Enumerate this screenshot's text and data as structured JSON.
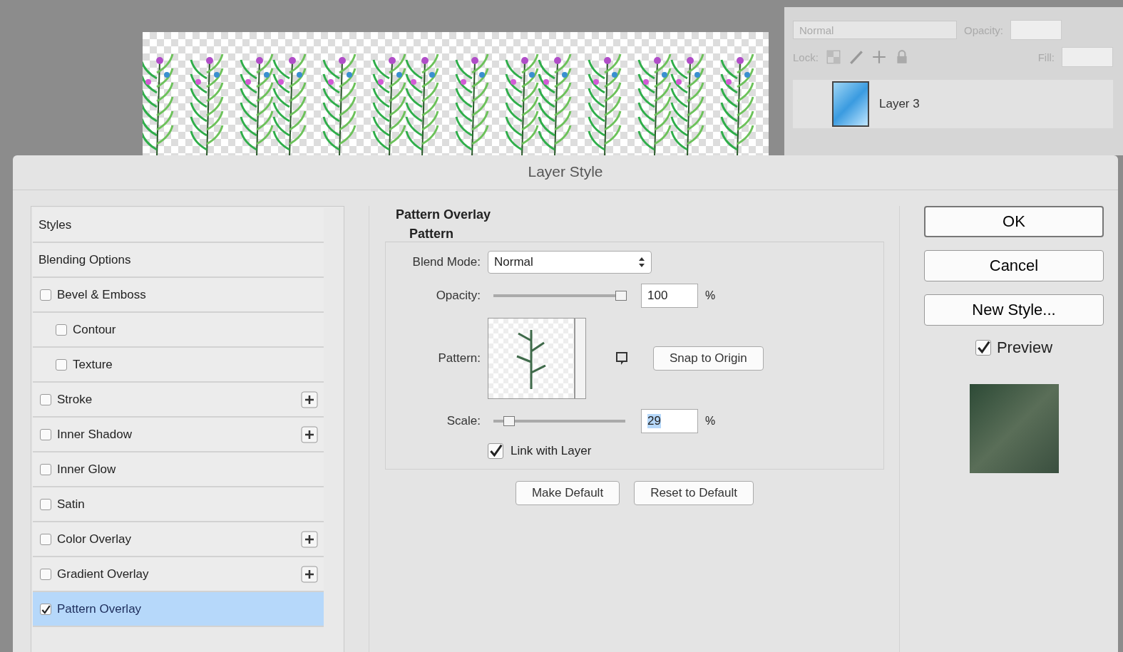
{
  "layers_panel": {
    "blend_mode": "Normal",
    "opacity_label": "Opacity:",
    "lock_label": "Lock:",
    "fill_label": "Fill:",
    "layers": [
      {
        "name": "Layer 3"
      }
    ]
  },
  "dialog": {
    "title": "Layer Style",
    "styles": [
      {
        "label": "Styles",
        "kind": "header",
        "selected": false
      },
      {
        "label": "Blending Options",
        "kind": "plain",
        "selected": false
      },
      {
        "label": "Bevel & Emboss",
        "kind": "check",
        "checked": false,
        "selected": false,
        "add_button": false,
        "children": [
          {
            "label": "Contour",
            "kind": "check",
            "checked": false,
            "selected": false,
            "add_button": false
          },
          {
            "label": "Texture",
            "kind": "check",
            "checked": false,
            "selected": false,
            "add_button": false
          }
        ]
      },
      {
        "label": "Stroke",
        "kind": "check",
        "checked": false,
        "selected": false,
        "add_button": true
      },
      {
        "label": "Inner Shadow",
        "kind": "check",
        "checked": false,
        "selected": false,
        "add_button": true
      },
      {
        "label": "Inner Glow",
        "kind": "check",
        "checked": false,
        "selected": false,
        "add_button": false
      },
      {
        "label": "Satin",
        "kind": "check",
        "checked": false,
        "selected": false,
        "add_button": false
      },
      {
        "label": "Color Overlay",
        "kind": "check",
        "checked": false,
        "selected": false,
        "add_button": true
      },
      {
        "label": "Gradient Overlay",
        "kind": "check",
        "checked": false,
        "selected": false,
        "add_button": true
      },
      {
        "label": "Pattern Overlay",
        "kind": "check",
        "checked": true,
        "selected": true,
        "add_button": false
      }
    ],
    "section": {
      "title": "Pattern Overlay",
      "subtitle": "Pattern",
      "blend_mode": {
        "label": "Blend Mode:",
        "value": "Normal"
      },
      "opacity": {
        "label": "Opacity:",
        "level": 0.97,
        "value": "100",
        "unit": "%"
      },
      "pattern": {
        "label": "Pattern:",
        "snap_button": "Snap to Origin"
      },
      "scale": {
        "label": "Scale:",
        "level": 0.12,
        "value": "29",
        "unit": "%"
      },
      "link": {
        "label": "Link with Layer",
        "checked": true
      },
      "buttons": [
        "Make Default",
        "Reset to Default"
      ]
    },
    "buttons": [
      "OK",
      "Cancel",
      "New Style..."
    ],
    "preview": {
      "label": "Preview",
      "checked": true
    }
  }
}
